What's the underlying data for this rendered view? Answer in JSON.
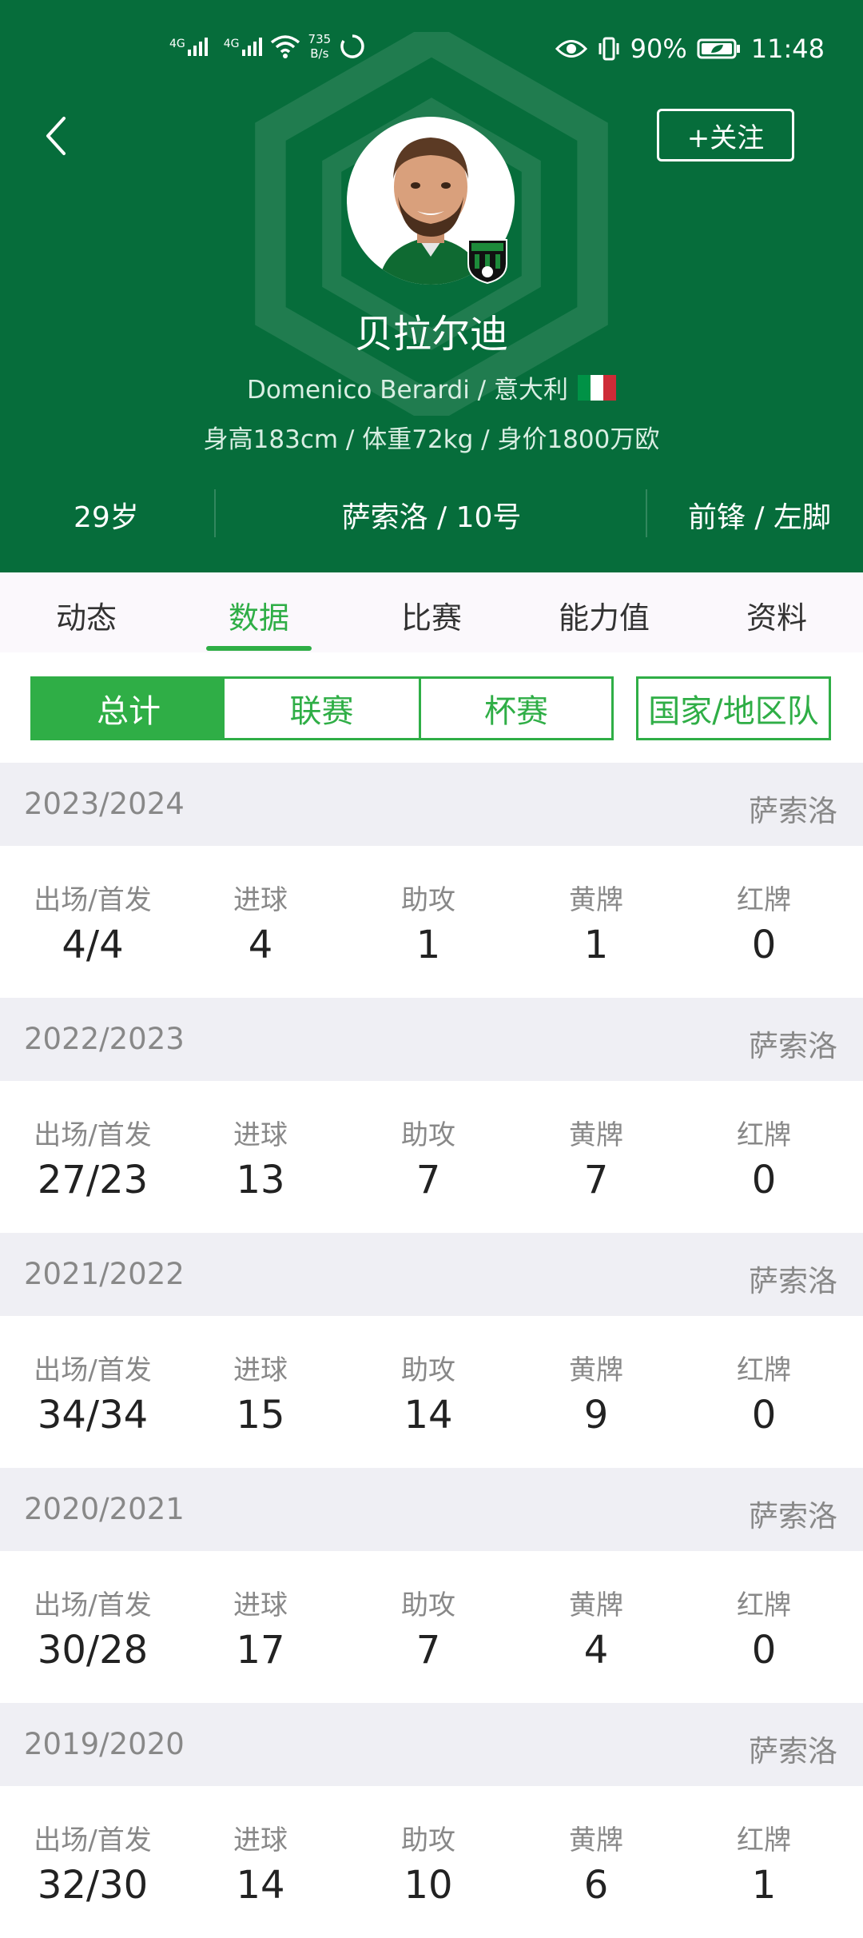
{
  "status_bar": {
    "signal1": "4G",
    "signal2": "4G",
    "net_speed_value": "735",
    "net_speed_unit": "B/s",
    "battery": "90%",
    "time": "11:48"
  },
  "header": {
    "follow_label": "+关注",
    "name": "贝拉尔迪",
    "name_en_country": "Domenico Berardi / 意大利",
    "physical": "身高183cm / 体重72kg / 身价1800万欧",
    "age": "29岁",
    "club_number": "萨索洛 / 10号",
    "position_foot": "前锋 / 左脚",
    "flag_colors": [
      "#009246",
      "#ffffff",
      "#ce2b37"
    ],
    "accent": "#066d3b"
  },
  "tabs": [
    "动态",
    "数据",
    "比赛",
    "能力值",
    "资料"
  ],
  "active_tab": "数据",
  "segments": [
    "总计",
    "联赛",
    "杯赛",
    "国家/地区队"
  ],
  "active_segment": "总计",
  "stat_labels": [
    "出场/首发",
    "进球",
    "助攻",
    "黄牌",
    "红牌"
  ],
  "seasons": [
    {
      "season": "2023/2024",
      "club": "萨索洛",
      "stats": [
        "4/4",
        "4",
        "1",
        "1",
        "0"
      ]
    },
    {
      "season": "2022/2023",
      "club": "萨索洛",
      "stats": [
        "27/23",
        "13",
        "7",
        "7",
        "0"
      ]
    },
    {
      "season": "2021/2022",
      "club": "萨索洛",
      "stats": [
        "34/34",
        "15",
        "14",
        "9",
        "0"
      ]
    },
    {
      "season": "2020/2021",
      "club": "萨索洛",
      "stats": [
        "30/28",
        "17",
        "7",
        "4",
        "0"
      ]
    },
    {
      "season": "2019/2020",
      "club": "萨索洛",
      "stats": [
        "32/30",
        "14",
        "10",
        "6",
        "1"
      ]
    }
  ]
}
